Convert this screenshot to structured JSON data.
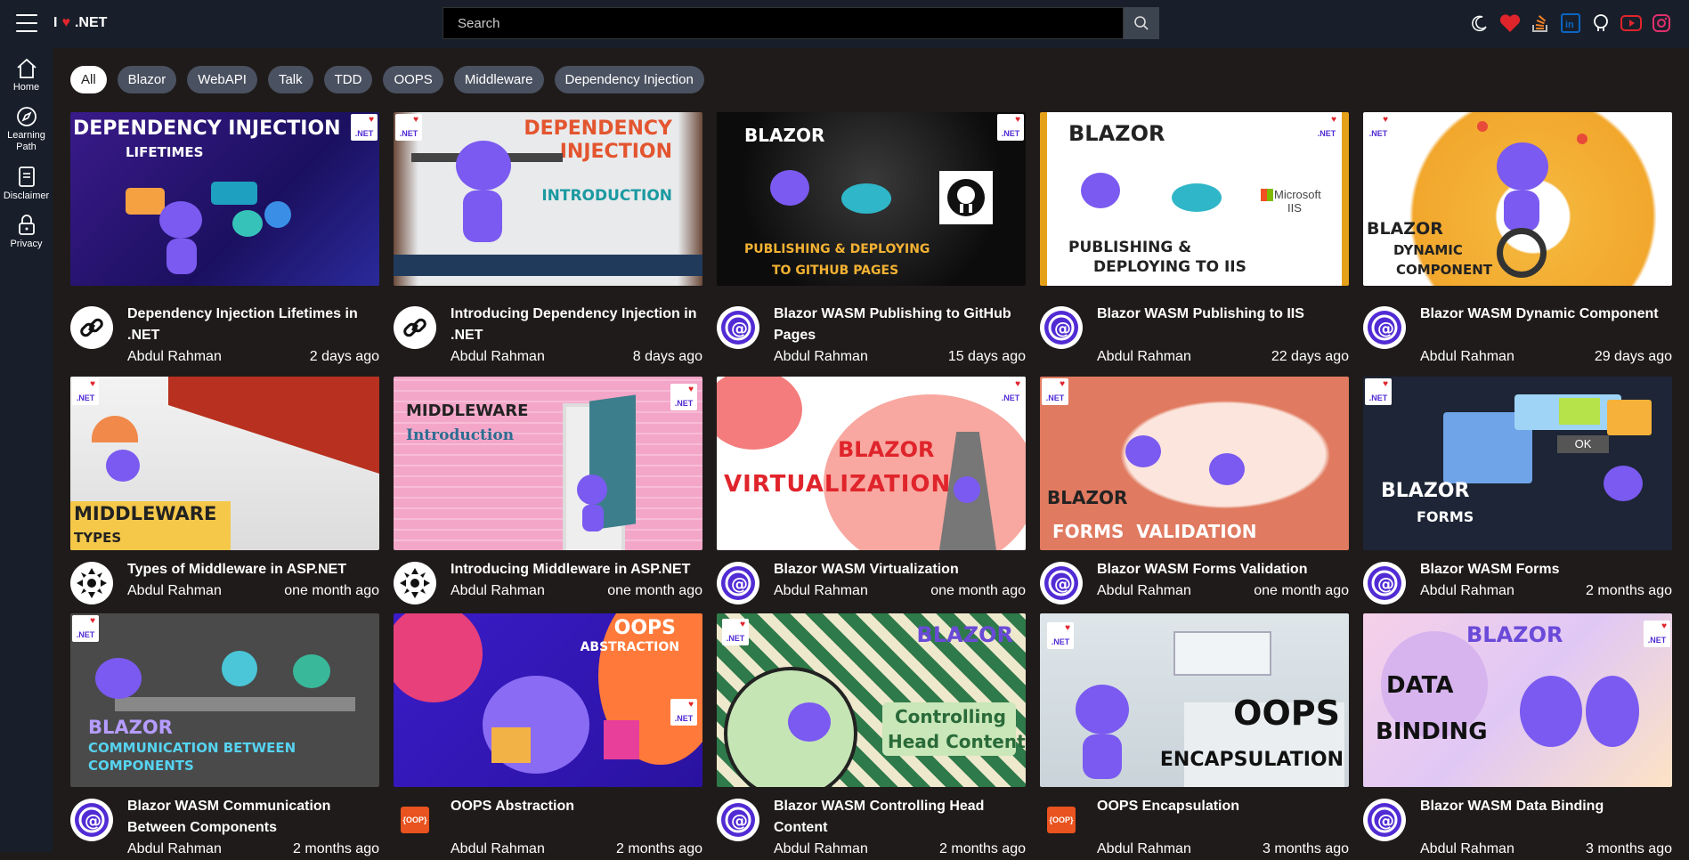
{
  "header": {
    "brand_prefix": "I",
    "brand_suffix": ".NET",
    "search_placeholder": "Search"
  },
  "sidebar": {
    "items": [
      {
        "label": "Home",
        "icon": "home-icon"
      },
      {
        "label": "Learning Path",
        "icon": "compass-icon"
      },
      {
        "label": "Disclaimer",
        "icon": "document-icon"
      },
      {
        "label": "Privacy",
        "icon": "lock-icon"
      }
    ]
  },
  "top_icons": [
    "moon-icon",
    "heart-icon",
    "stackoverflow-icon",
    "linkedin-icon",
    "github-icon",
    "youtube-icon",
    "instagram-icon"
  ],
  "filters": [
    "All",
    "Blazor",
    "WebAPI",
    "Talk",
    "TDD",
    "OOPS",
    "Middleware",
    "Dependency Injection"
  ],
  "active_filter": "All",
  "videos": [
    {
      "title": "Dependency Injection Lifetimes in .NET",
      "author": "Abdul Rahman",
      "age": "2 days ago",
      "avatar": "link",
      "thumb_text": [
        "DEPENDENCY INJECTION",
        "LIFETIMES"
      ]
    },
    {
      "title": "Introducing Dependency Injection in .NET",
      "author": "Abdul Rahman",
      "age": "8 days ago",
      "avatar": "link",
      "thumb_text": [
        "DEPENDENCY",
        "INJECTION",
        "INTRODUCTION"
      ]
    },
    {
      "title": "Blazor WASM Publishing to GitHub Pages",
      "author": "Abdul Rahman",
      "age": "15 days ago",
      "avatar": "blazor",
      "thumb_text": [
        "BLAZOR",
        "PUBLISHING & DEPLOYING",
        "TO GITHUB PAGES"
      ]
    },
    {
      "title": "Blazor WASM Publishing to IIS",
      "author": "Abdul Rahman",
      "age": "22 days ago",
      "avatar": "blazor",
      "thumb_text": [
        "BLAZOR",
        "PUBLISHING &",
        "DEPLOYING TO IIS",
        "Microsoft",
        "IIS"
      ]
    },
    {
      "title": "Blazor WASM Dynamic Component",
      "author": "Abdul Rahman",
      "age": "29 days ago",
      "avatar": "blazor",
      "thumb_text": [
        "BLAZOR",
        "DYNAMIC",
        "COMPONENT"
      ]
    },
    {
      "title": "Types of Middleware in ASP.NET",
      "author": "Abdul Rahman",
      "age": "one month ago",
      "avatar": "middleware",
      "thumb_text": [
        "MIDDLEWARE",
        "TYPES"
      ]
    },
    {
      "title": "Introducing Middleware in ASP.NET",
      "author": "Abdul Rahman",
      "age": "one month ago",
      "avatar": "middleware",
      "thumb_text": [
        "MIDDLEWARE",
        "Introduction"
      ]
    },
    {
      "title": "Blazor WASM Virtualization",
      "author": "Abdul Rahman",
      "age": "one month ago",
      "avatar": "blazor",
      "thumb_text": [
        "BLAZOR",
        "VIRTUALIZATION"
      ]
    },
    {
      "title": "Blazor WASM Forms Validation",
      "author": "Abdul Rahman",
      "age": "one month ago",
      "avatar": "blazor",
      "thumb_text": [
        "BLAZOR",
        "FORMS  VALIDATION"
      ]
    },
    {
      "title": "Blazor WASM Forms",
      "author": "Abdul Rahman",
      "age": "2 months ago",
      "avatar": "blazor",
      "thumb_text": [
        "BLAZOR",
        "FORMS",
        "OK"
      ]
    },
    {
      "title": "Blazor WASM Communication Between Components",
      "author": "Abdul Rahman",
      "age": "2 months ago",
      "avatar": "blazor",
      "thumb_text": [
        "BLAZOR",
        "COMMUNICATION BETWEEN",
        "COMPONENTS"
      ]
    },
    {
      "title": "OOPS Abstraction",
      "author": "Abdul Rahman",
      "age": "2 months ago",
      "avatar": "oop",
      "thumb_text": [
        "OOPS",
        "ABSTRACTION"
      ]
    },
    {
      "title": "Blazor WASM Controlling Head Content",
      "author": "Abdul Rahman",
      "age": "2 months ago",
      "avatar": "blazor",
      "thumb_text": [
        "BLAZOR",
        "Controlling",
        "Head Content"
      ]
    },
    {
      "title": "OOPS Encapsulation",
      "author": "Abdul Rahman",
      "age": "3 months ago",
      "avatar": "oop",
      "thumb_text": [
        "OOPS",
        "ENCAPSULATION"
      ]
    },
    {
      "title": "Blazor WASM Data Binding",
      "author": "Abdul Rahman",
      "age": "3 months ago",
      "avatar": "blazor",
      "thumb_text": [
        "BLAZOR",
        "DATA",
        "BINDING"
      ]
    }
  ],
  "net_badge": ".NET",
  "oop_badge": "{OOP}",
  "colors": {
    "accent": "#512bd4",
    "heart": "#e0242b",
    "topbar": "#181f2b",
    "background": "#1f1b1a"
  }
}
